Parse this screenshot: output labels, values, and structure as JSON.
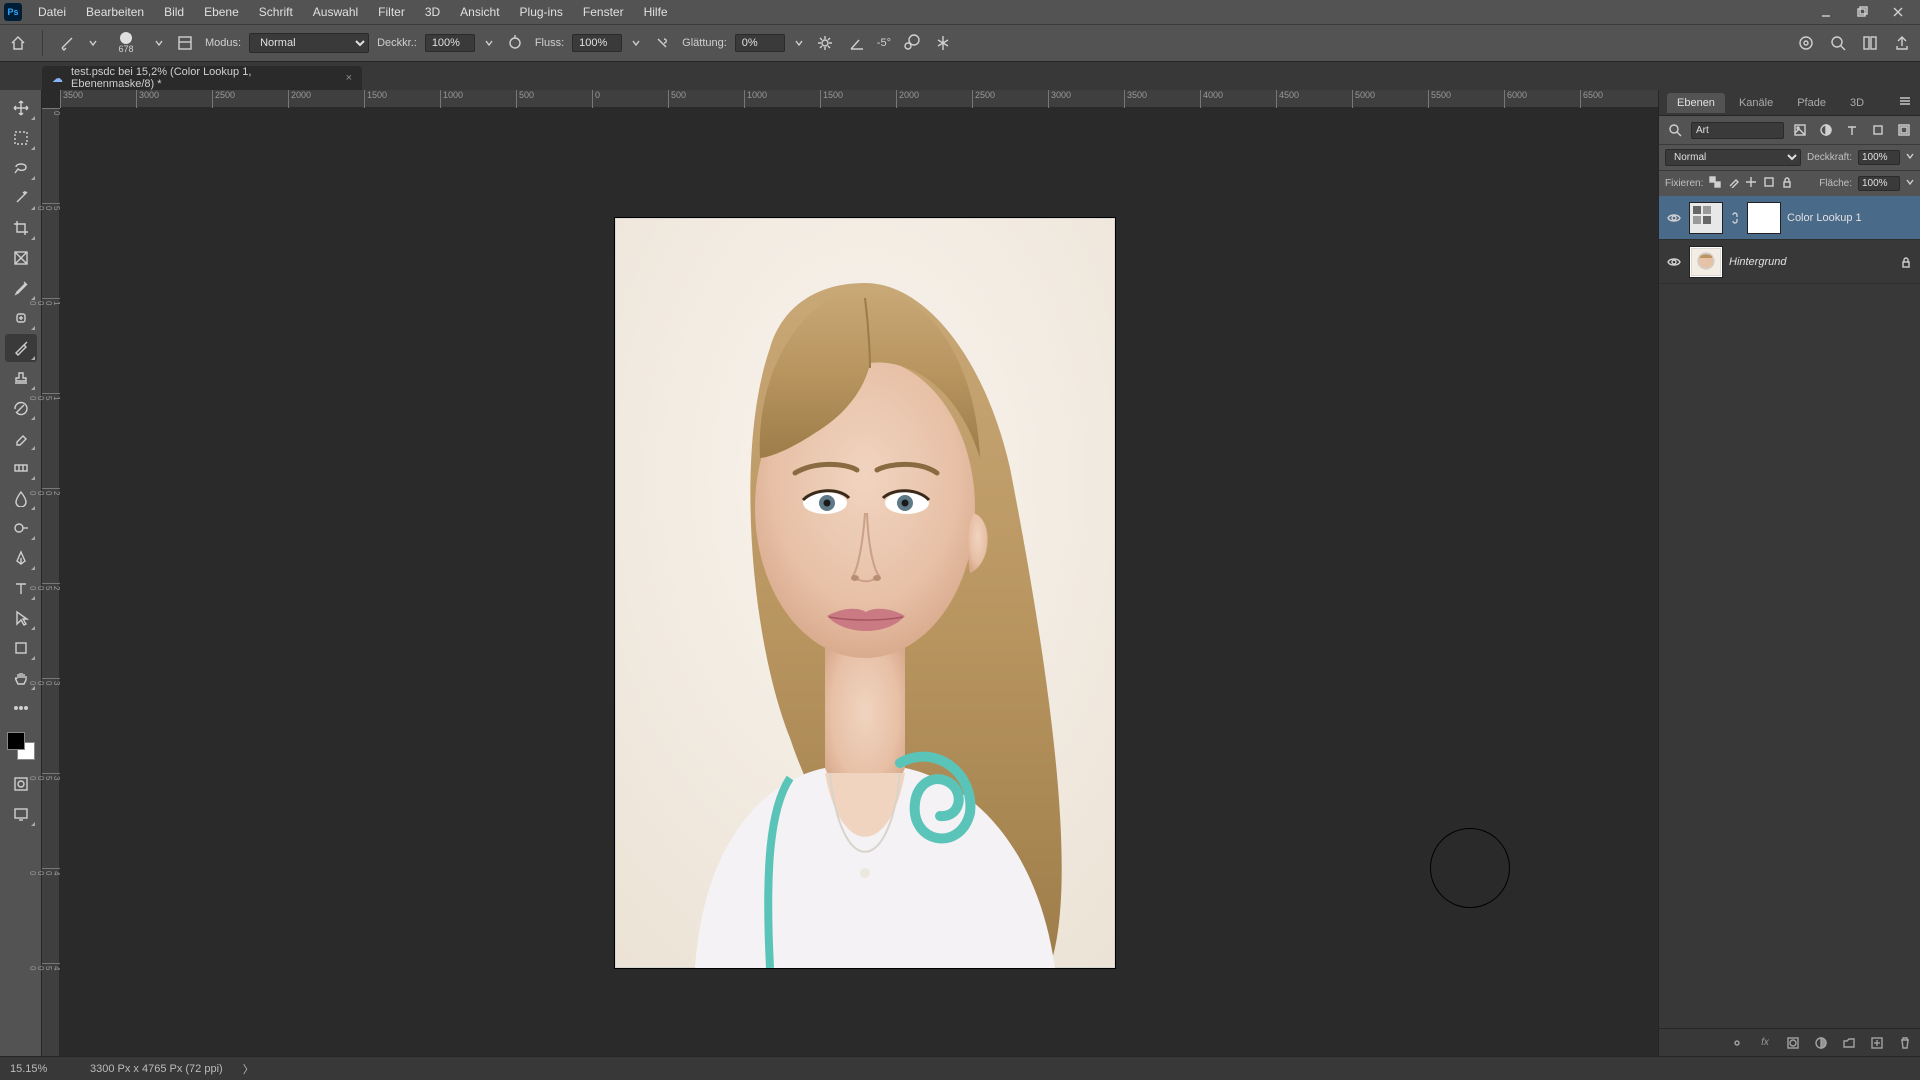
{
  "app": {
    "logo_text": "Ps"
  },
  "menu": {
    "items": [
      "Datei",
      "Bearbeiten",
      "Bild",
      "Ebene",
      "Schrift",
      "Auswahl",
      "Filter",
      "3D",
      "Ansicht",
      "Plug-ins",
      "Fenster",
      "Hilfe"
    ]
  },
  "options": {
    "brush_size": "678",
    "mode_label": "Modus:",
    "mode_value": "Normal",
    "opacity_label": "Deckkr.:",
    "opacity_value": "100%",
    "flow_label": "Fluss:",
    "flow_value": "100%",
    "smoothing_label": "Glättung:",
    "smoothing_value": "0%",
    "angle_value": "-5°"
  },
  "document": {
    "tab_title": "test.psdc bei 15,2% (Color Lookup 1, Ebenenmaske/8) *"
  },
  "ruler_h": [
    "-3500",
    "-3000",
    "-2500",
    "-2000",
    "-1500",
    "-1000",
    "-500",
    "0",
    "500",
    "1000",
    "1500",
    "2000",
    "2500",
    "3000",
    "3500",
    "4000",
    "4500",
    "5000",
    "5500",
    "6000",
    "6500"
  ],
  "ruler_v": [
    "0",
    "500",
    "1000",
    "1500",
    "2000",
    "2500",
    "3000",
    "3500",
    "4000",
    "4500"
  ],
  "panels": {
    "tabs": [
      "Ebenen",
      "Kanäle",
      "Pfade",
      "3D"
    ],
    "active_tab": "Ebenen",
    "search_placeholder": "Art",
    "blend_mode": "Normal",
    "opacity_label": "Deckkraft:",
    "opacity_value": "100%",
    "lock_label": "Fixieren:",
    "fill_label": "Fläche:",
    "fill_value": "100%"
  },
  "layers": [
    {
      "name": "Color Lookup 1",
      "type": "adjustment",
      "visible": true,
      "selected": true,
      "locked": false
    },
    {
      "name": "Hintergrund",
      "type": "image",
      "visible": true,
      "selected": false,
      "locked": true,
      "italic": true
    }
  ],
  "status": {
    "zoom": "15.15%",
    "doc_info": "3300 Px x 4765 Px (72 ppi)"
  }
}
